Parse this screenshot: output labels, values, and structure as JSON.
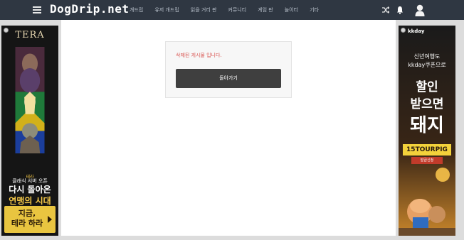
{
  "header": {
    "logo": "DogDrip.net",
    "nav": [
      "개드립",
      "유저 개드립",
      "읽을 거리 판",
      "커뮤니티",
      "게임 판",
      "놀이터",
      "기타"
    ]
  },
  "icons": {
    "menu": "hamburger-menu-icon",
    "shuffle": "shuffle-icon",
    "notifications": "bell-icon",
    "user": "user-avatar-icon"
  },
  "notice": {
    "message": "삭제된 게시물 입니다.",
    "back_label": "돌아가기"
  },
  "ad_left": {
    "logo": "TERA",
    "badge": "테라",
    "line1": "클래식 서버 오픈",
    "line2": "다시 돌아온",
    "line3": "연맹의 시대",
    "cta_line1": "지금,",
    "cta_line2": "테라 하라"
  },
  "ad_right": {
    "logo": "kkday",
    "line1": "신년여행도",
    "line2": "kkday쿠폰으로",
    "big1": "할인",
    "big2": "받으면",
    "big3": "돼지",
    "code": "15TOURPIG",
    "button": "발급신청"
  },
  "colors": {
    "topbar": "#2f3742",
    "page_bg": "#dcdcdc",
    "error_text": "#d9534f",
    "button_bg": "#3f3f3f"
  }
}
